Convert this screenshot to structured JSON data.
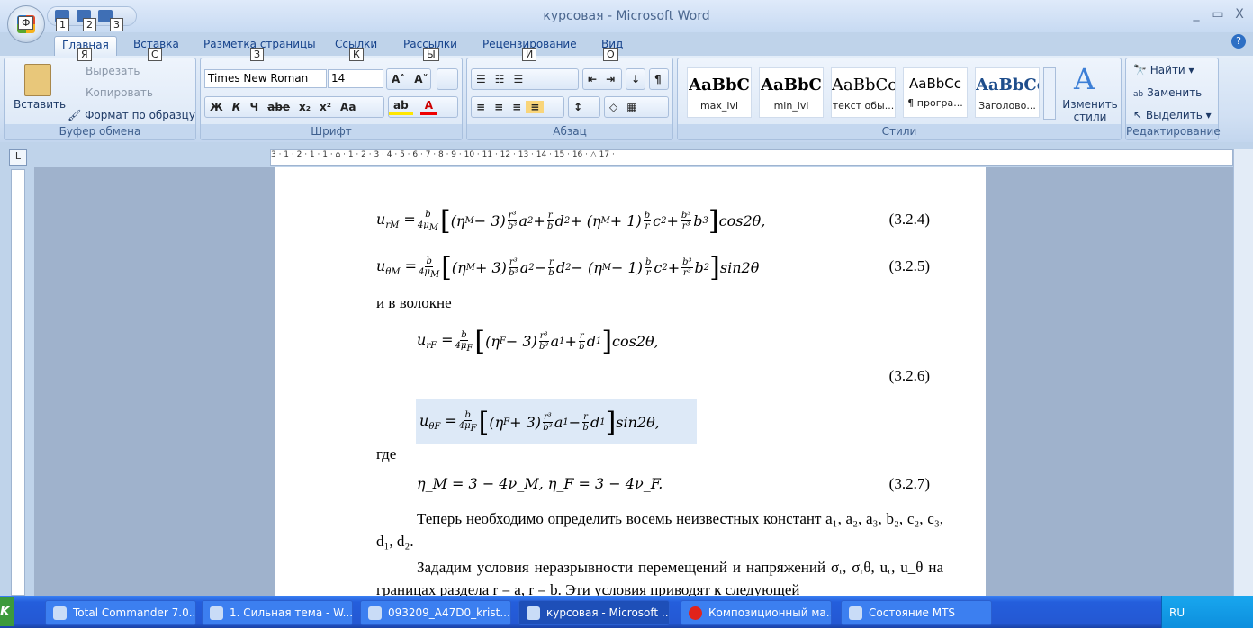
{
  "window": {
    "title": "курсовая - Microsoft Word",
    "minimize": "_",
    "maximize": "▭",
    "close": "X",
    "help": "?"
  },
  "qat_keytips": [
    "1",
    "2",
    "3"
  ],
  "office_keytip": "Ф",
  "tabs": [
    {
      "label": "Главная",
      "key": "Я"
    },
    {
      "label": "Вставка",
      "key": "С"
    },
    {
      "label": "Разметка страницы",
      "key": "З"
    },
    {
      "label": "Ссылки",
      "key": "К"
    },
    {
      "label": "Рассылки",
      "key": "Ы"
    },
    {
      "label": "Рецензирование",
      "key": "И"
    },
    {
      "label": "Вид",
      "key": "О"
    }
  ],
  "clipboard": {
    "label": "Буфер обмена",
    "paste": "Вставить",
    "cut": "Вырезать",
    "copy": "Копировать",
    "format_painter": "Формат по образцу"
  },
  "font": {
    "label": "Шрифт",
    "name": "Times New Roman",
    "size": "14",
    "bold": "Ж",
    "italic": "К",
    "underline": "Ч",
    "strike": "abe",
    "sub": "x₂",
    "sup": "x²",
    "case": "Aa",
    "grow": "A˄",
    "shrink": "A˅"
  },
  "paragraph": {
    "label": "Абзац"
  },
  "styles": {
    "label": "Стили",
    "items": [
      {
        "preview": "AaBbC",
        "name": "max_lvl"
      },
      {
        "preview": "AaBbC",
        "name": "min_lvl"
      },
      {
        "preview": "AaBbCc",
        "name": "текст обы..."
      },
      {
        "preview": "AaBbCc",
        "name": "¶ програ..."
      },
      {
        "preview": "AaBbCc",
        "name": "Заголово..."
      }
    ],
    "change": "Изменить стили"
  },
  "editing": {
    "label": "Редактирование",
    "find": "Найти",
    "replace": "Заменить",
    "select": "Выделить"
  },
  "ruler": {
    "marks": "3 · 1 · 2 · 1 · 1 · ⌂ · 1 · 2 · 3 · 4 · 5 · 6 · 7 · 8 · 9 · 10 · 11 · 12 · 13 · 14 · 15 · 16 · △ 17 ·"
  },
  "document": {
    "eq1": {
      "lhs": "u",
      "lhs_sub": "rM",
      "num": "(3.2.4)"
    },
    "eq2": {
      "lhs": "u",
      "lhs_sub": "θM",
      "num": "(3.2.5)"
    },
    "text1": "и в волокне",
    "eq3": {
      "lhs": "u",
      "lhs_sub": "rF",
      "num": "(3.2.6)"
    },
    "eq4": {
      "lhs": "u",
      "lhs_sub": "θF"
    },
    "text2": "где",
    "eq5": {
      "text": "η_M = 3 − 4ν_M,     η_F = 3 − 4ν_F.",
      "num": "(3.2.7)"
    },
    "para1": "Теперь необходимо определить восемь неизвестных констант a₁, a₂, a₃, b₂, c₂, c₃, d₁, d₂.",
    "para2": "Зададим условия неразрывности перемещений и напряжений σᵣ, σᵣθ, uᵣ, u_θ на границах раздела r = a, r = b. Эти условия приводят к следующей"
  },
  "taskbar": {
    "start": "K",
    "items": [
      "Total Commander 7.0...",
      "1. Сильная тема - W...",
      "093209_A47D0_krist...",
      "курсовая - Microsoft ...",
      "Композиционный ма...",
      "Состояние MTS"
    ],
    "lang": "RU"
  }
}
